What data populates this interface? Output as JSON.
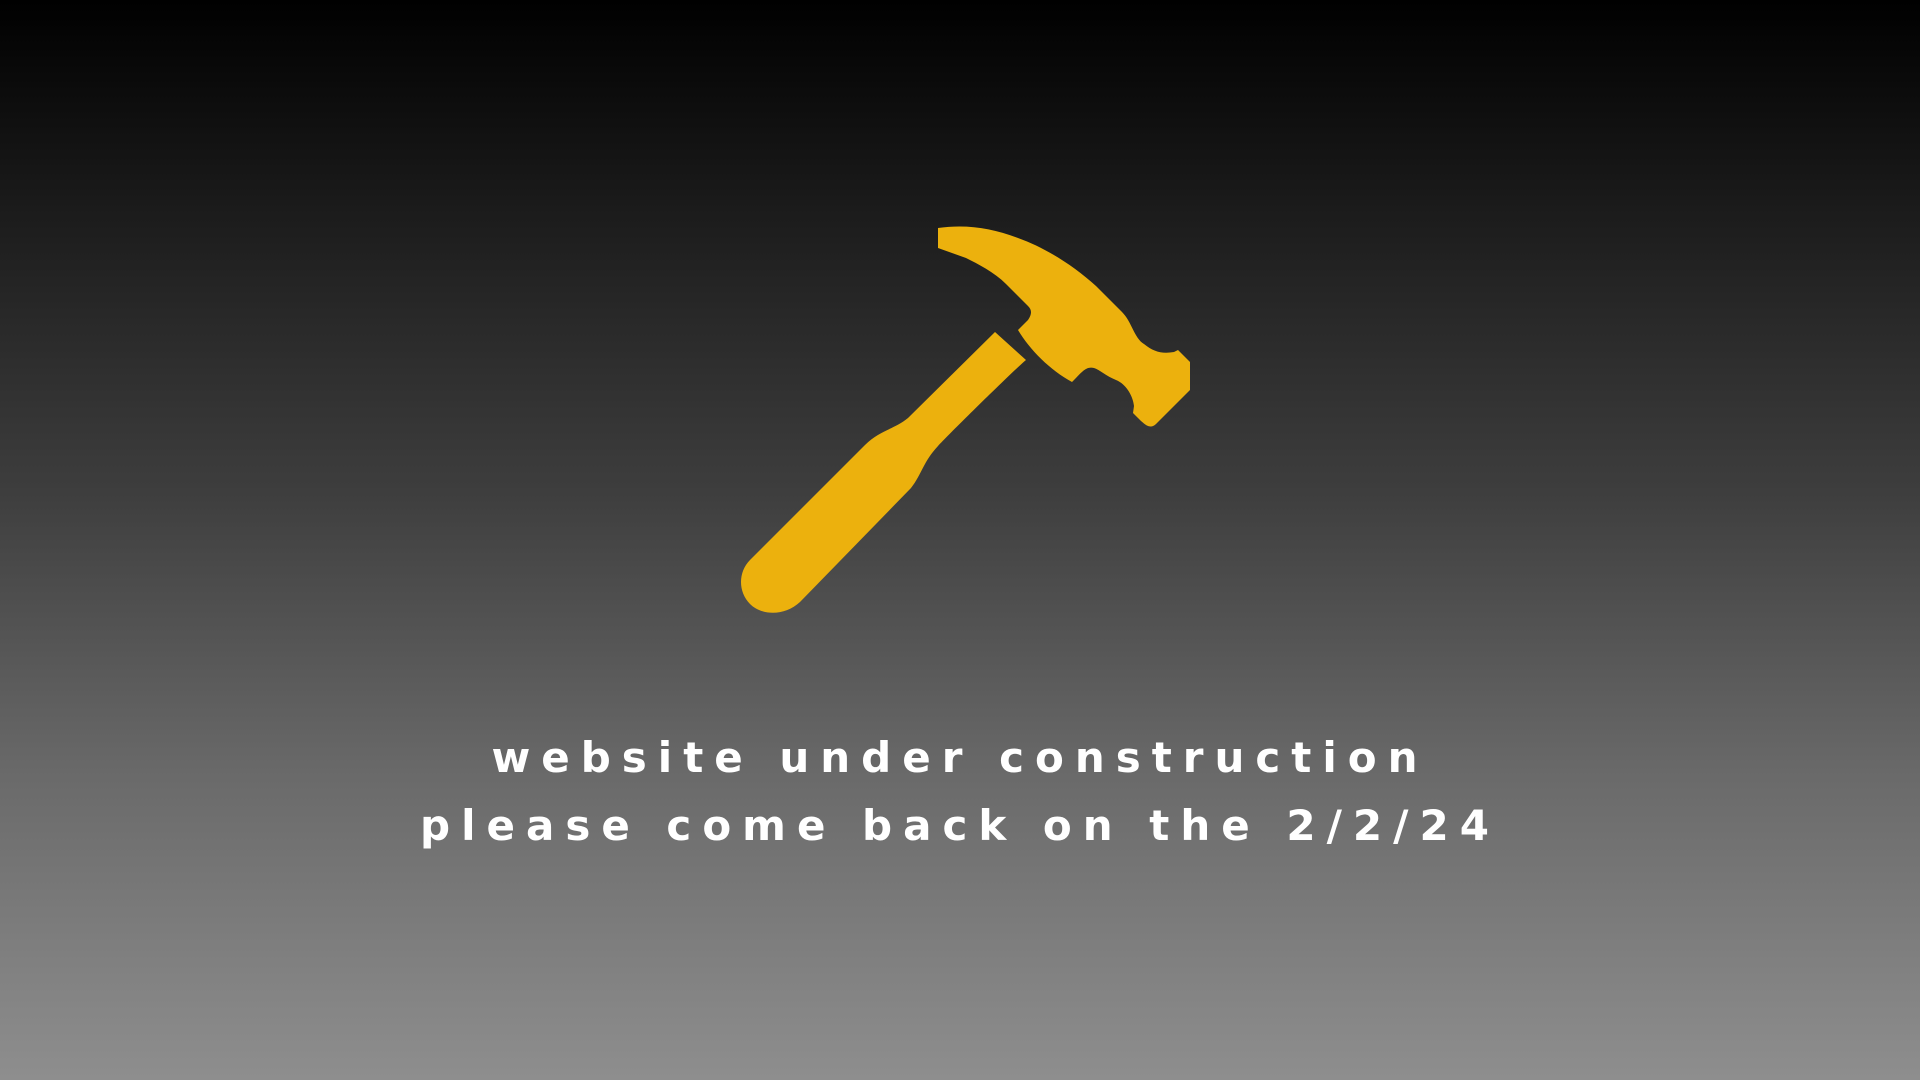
{
  "icon": {
    "name": "hammer-icon",
    "color": "#ecb10d"
  },
  "message": {
    "line1": "website under construction",
    "line2": "please come back on the 2/2/24"
  },
  "colors": {
    "background_top": "#000000",
    "background_bottom": "#8e8e8e",
    "text": "#ffffff"
  }
}
